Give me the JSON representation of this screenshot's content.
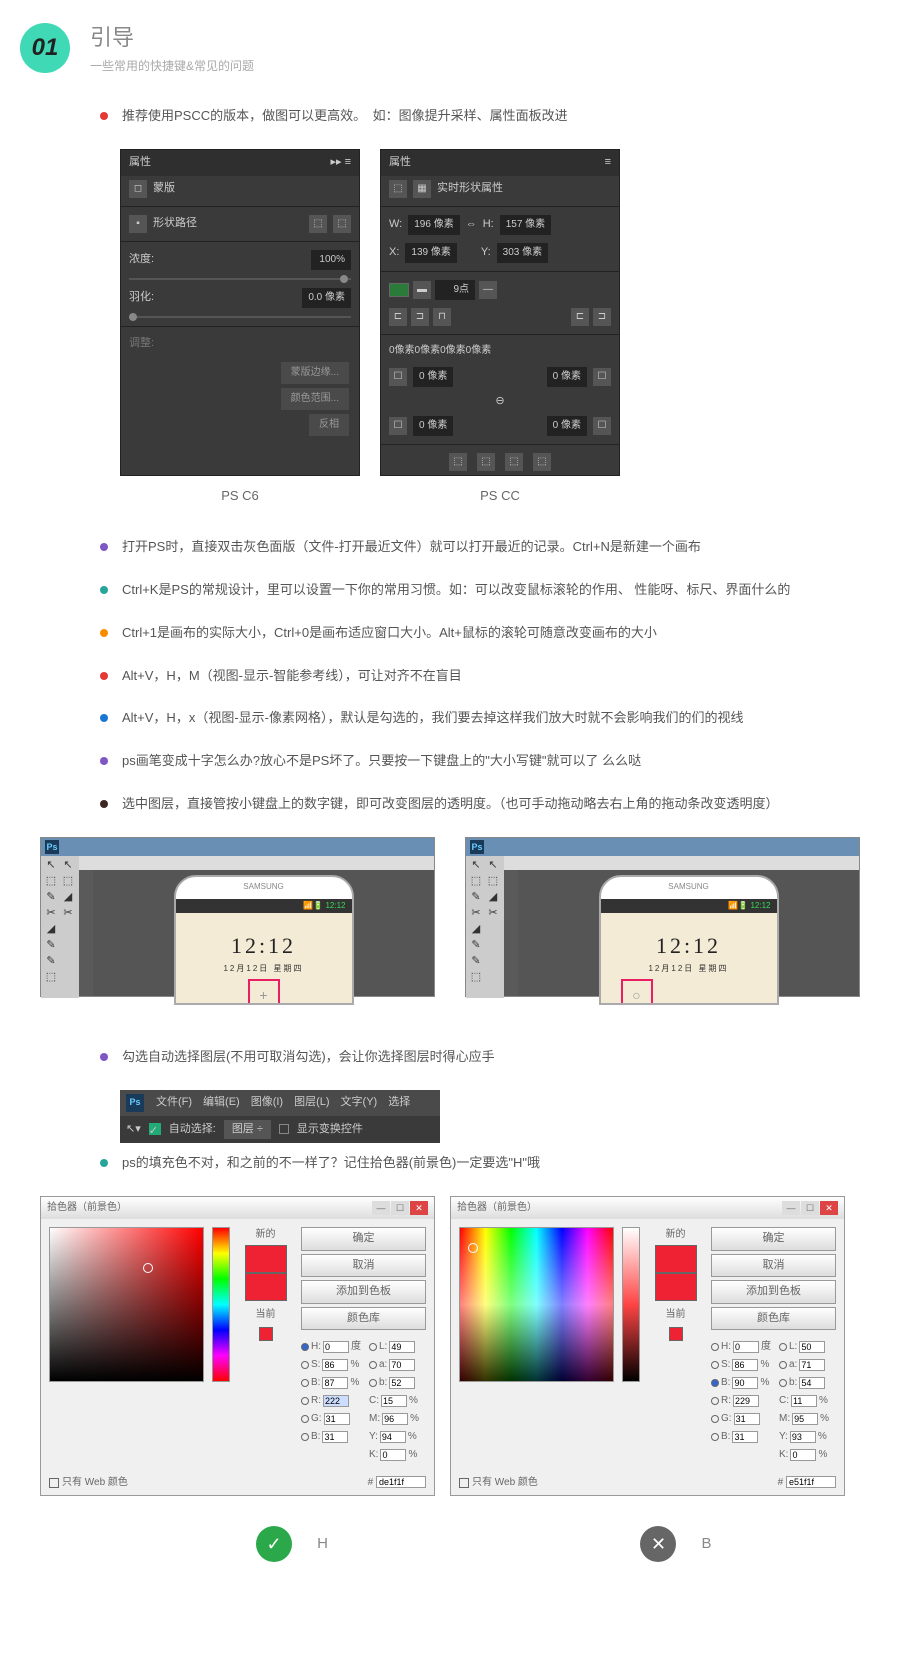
{
  "header": {
    "num": "01",
    "title": "引导",
    "subtitle": "一些常用的快捷键&常见的问题"
  },
  "intro": "推荐使用PSCC的版本，做图可以更高效。　如：图像提升采样、属性面板改进",
  "panelA": {
    "title": "属性",
    "mask": "蒙版",
    "path": "形状路径",
    "density": "浓度:",
    "densityVal": "100%",
    "feather": "羽化:",
    "featherVal": "0.0 像素",
    "adjust": "调整:",
    "btn1": "蒙版边缘...",
    "btn2": "颜色范围...",
    "btn3": "反相"
  },
  "panelB": {
    "title": "属性",
    "shape": "实时形状属性",
    "w": "W:",
    "wVal": "196 像素",
    "h": "H:",
    "hVal": "157 像素",
    "x": "X:",
    "xVal": "139 像素",
    "y": "Y:",
    "yVal": "303 像素",
    "pt": "9点",
    "corners": "0像素0像素0像素0像素",
    "zero": "0 像素"
  },
  "caps": {
    "a": "PS C6",
    "b": "PS CC"
  },
  "tips": [
    {
      "c": "purple",
      "t": "打开PS时，直接双击灰色面版（文件-打开最近文件）就可以打开最近的记录。Ctrl+N是新建一个画布"
    },
    {
      "c": "teal",
      "t": "Ctrl+K是PS的常规设计，里可以设置一下你的常用习惯。如：可以改变鼠标滚轮的作用、 性能呀、标尺、界面什么的"
    },
    {
      "c": "orange",
      "t": "Ctrl+1是画布的实际大小，Ctrl+0是画布适应窗口大小。Alt+鼠标的滚轮可随意改变画布的大小"
    },
    {
      "c": "red",
      "t": "Alt+V，H，M（视图-显示-智能参考线），可让对齐不在盲目"
    },
    {
      "c": "blue",
      "t": "Alt+V，H，x（视图-显示-像素网格），默认是勾选的，我们要去掉这样我们放大时就不会影响我们的们的视线"
    },
    {
      "c": "purple",
      "t": "ps画笔变成十字怎么办?放心不是PS坏了。只要按一下键盘上的\"大小写键\"就可以了 么么哒"
    },
    {
      "c": "dark",
      "t": "选中图层，直接管按小键盘上的数字键，即可改变图层的透明度。（也可手动拖动略去右上角的拖动条改变透明度）"
    }
  ],
  "phone": {
    "clock": "12:12",
    "date": "12月12日 星期四",
    "time": "12:12",
    "brand": "SAMSUNG"
  },
  "tip2": {
    "c": "purple",
    "t": "勾选自动选择图层(不用可取消勾选)，会让你选择图层时得心应手"
  },
  "menu": {
    "items": [
      "文件(F)",
      "编辑(E)",
      "图像(I)",
      "图层(L)",
      "文字(Y)",
      "选择"
    ],
    "auto": "自动选择:",
    "layer": "图层",
    "show": "显示变换控件"
  },
  "tip3": {
    "c": "teal",
    "t": "ps的填充色不对，和之前的不一样了？记住拾色器(前景色)一定要选\"H\"哦"
  },
  "picker": {
    "title": "拾色器（前景色）",
    "new": "新的",
    "cur": "当前",
    "ok": "确定",
    "cancel": "取消",
    "add": "添加到色板",
    "lib": "颜色库",
    "web": "只有 Web 颜色"
  },
  "pA": {
    "H": "0",
    "S": "86",
    "B": "87",
    "R": "222",
    "G": "31",
    "B2": "31",
    "L": "49",
    "a": "70",
    "b": "52",
    "C": "15",
    "M": "96",
    "Y": "94",
    "K": "0",
    "hex": "de1f1f"
  },
  "pB": {
    "H": "0",
    "S": "86",
    "B": "90",
    "R": "229",
    "G": "31",
    "B2": "31",
    "L": "50",
    "a": "71",
    "b": "54",
    "C": "11",
    "M": "95",
    "Y": "93",
    "K": "0",
    "hex": "e51f1f"
  },
  "verdict": {
    "ok": "H",
    "no": "B"
  }
}
